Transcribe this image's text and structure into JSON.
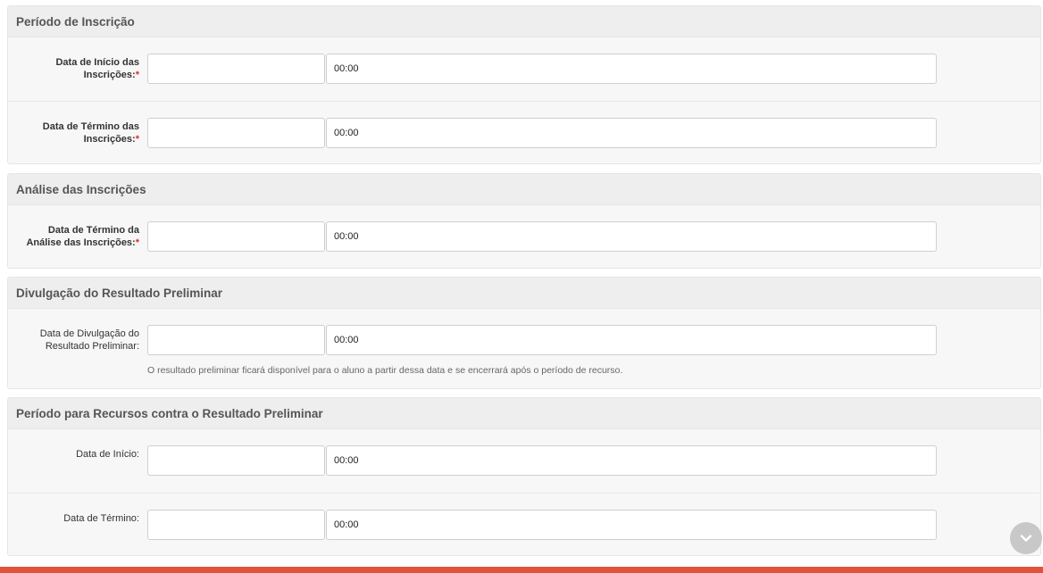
{
  "sections": [
    {
      "title": "Período de Inscrição",
      "rows": [
        {
          "label": "Data de Início das Inscrições:",
          "label_lines": [
            "Data de Início das",
            "Inscrições:"
          ],
          "required": true,
          "time": "00:00"
        },
        {
          "label": "Data de Término das Inscrições:",
          "label_lines": [
            "Data de Término das",
            "Inscrições:"
          ],
          "required": true,
          "time": "00:00"
        }
      ]
    },
    {
      "title": "Análise das Inscrições",
      "rows": [
        {
          "label_lines": [
            "Data de Término da",
            "Análise das Inscrições:"
          ],
          "required": true,
          "time": "00:00"
        }
      ]
    },
    {
      "title": "Divulgação do Resultado Preliminar",
      "rows": [
        {
          "label_lines": [
            "Data de Divulgação do",
            "Resultado Preliminar:"
          ],
          "required": false,
          "time": "00:00",
          "help": "O resultado preliminar ficará disponível para o aluno a partir dessa data e se encerrará após o período de recurso."
        }
      ]
    },
    {
      "title": "Período para Recursos contra o Resultado Preliminar",
      "rows": [
        {
          "label_lines": [
            "Data de Início:"
          ],
          "required": false,
          "time": "00:00"
        },
        {
          "label_lines": [
            "Data de Término:"
          ],
          "required": false,
          "time": "00:00"
        }
      ]
    }
  ],
  "required_marker": "*",
  "icons": {
    "scroll": "chevron-down-icon"
  },
  "colors": {
    "required": "#d9342b",
    "bottom_bar": "#e0523c"
  }
}
